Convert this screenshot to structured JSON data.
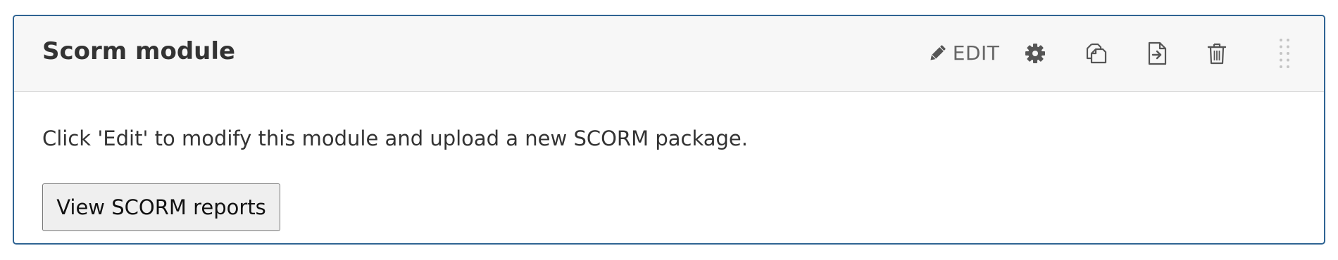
{
  "module": {
    "title": "Scorm module",
    "toolbar": {
      "edit_label": "EDIT",
      "edit_icon": "pencil-icon",
      "settings_icon": "gear-icon",
      "duplicate_icon": "duplicate-icon",
      "export_icon": "export-icon",
      "delete_icon": "trash-icon",
      "drag_icon": "drag-handle-icon"
    },
    "body": {
      "instructions": "Click 'Edit' to modify this module and upload a new SCORM package.",
      "reports_button_label": "View SCORM reports"
    }
  },
  "colors": {
    "border": "#2f6493",
    "header_background": "#f7f7f7",
    "icon": "#555555",
    "text": "#333333"
  }
}
